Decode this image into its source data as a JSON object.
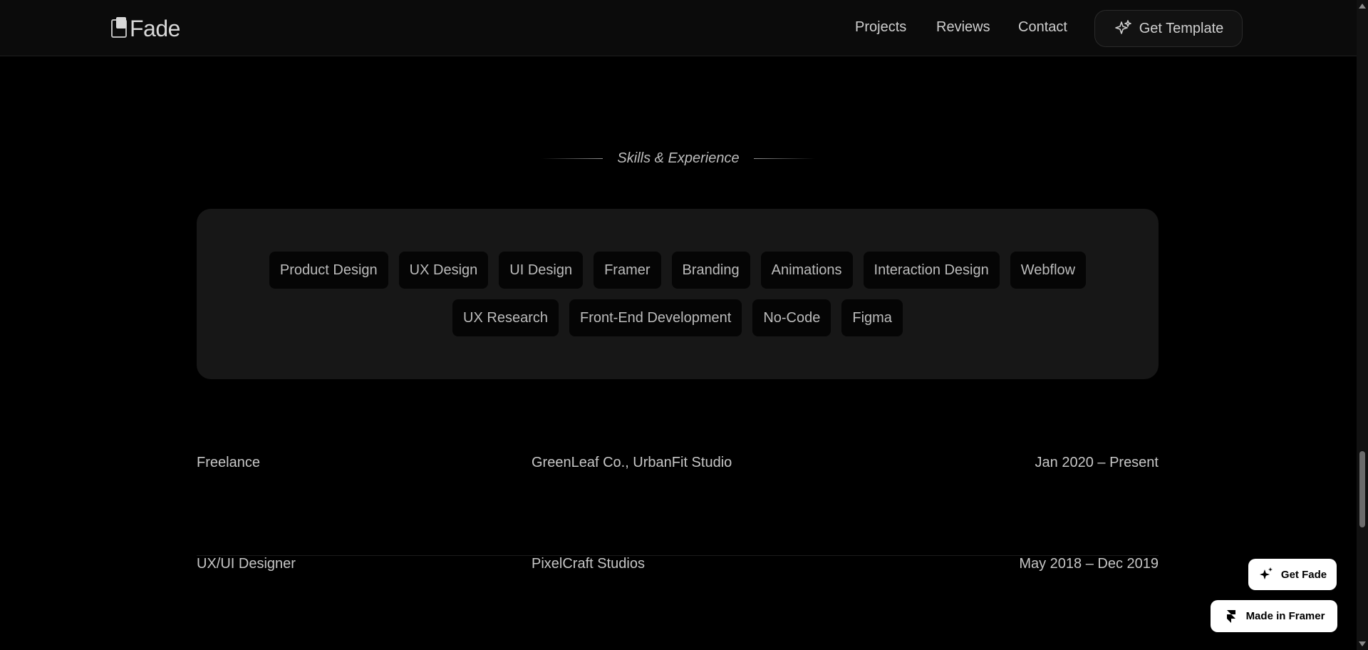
{
  "header": {
    "logo_text": "Fade",
    "nav": [
      {
        "label": "Projects"
      },
      {
        "label": "Reviews"
      },
      {
        "label": "Contact"
      }
    ],
    "cta_label": "Get Template",
    "cta_icon": "sparkle-icon"
  },
  "section": {
    "title": "Skills & Experience"
  },
  "skills": [
    [
      "Product Design",
      "UX Design",
      "UI Design",
      "Framer",
      "Branding",
      "Animations",
      "Interaction Design",
      "Webflow"
    ],
    [
      "UX Research",
      "Front-End Development",
      "No-Code",
      "Figma"
    ]
  ],
  "experience": [
    {
      "role": "Freelance",
      "company": "GreenLeaf Co., UrbanFit Studio",
      "dates": "Jan 2020 – Present"
    },
    {
      "role": "UX/UI Designer",
      "company": "PixelCraft Studios",
      "dates": "May 2018 – Dec 2019"
    }
  ],
  "badges": {
    "get_fade": "Get Fade",
    "made_in_framer": "Made in Framer"
  },
  "colors": {
    "background": "#000000",
    "card": "#171717",
    "pill": "#050505",
    "badge": "#ffffff"
  }
}
